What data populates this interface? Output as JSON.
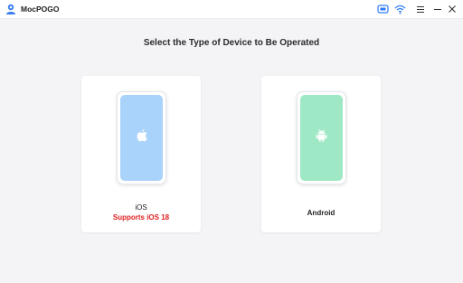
{
  "window": {
    "title": "MocPOGO",
    "buttons": [
      "device-icon",
      "wifi-icon",
      "menu-icon",
      "minimize-icon",
      "close-icon"
    ]
  },
  "main": {
    "heading": "Select the Type of Device to Be Operated",
    "cards": [
      {
        "label": "iOS",
        "sub_label": "Supports iOS 18",
        "icon": "apple-icon",
        "screen_color": "#a9d3fb"
      },
      {
        "label": "Android",
        "icon": "android-icon",
        "screen_color": "#9fe8c5"
      }
    ]
  },
  "colors": {
    "accent": "#2f7cf6",
    "warning": "#e02020",
    "background": "#f4f4f7"
  }
}
